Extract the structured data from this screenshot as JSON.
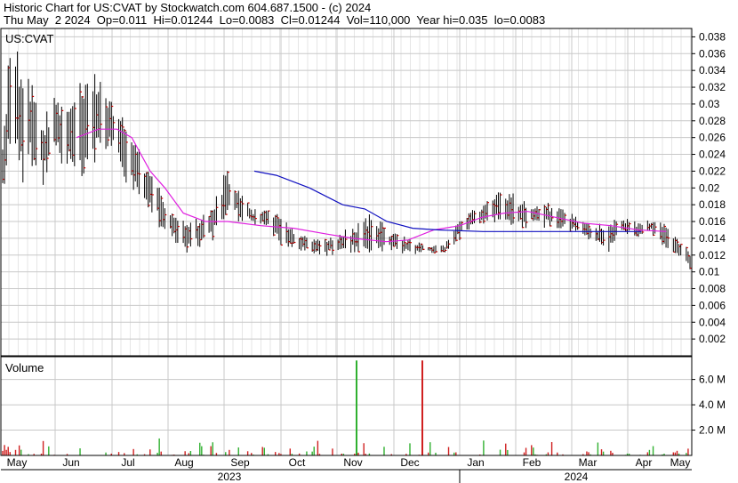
{
  "header": {
    "line1": "Historic Chart for US:CVAT by Stockwatch.com 604.687.1500 - (c) 2024",
    "line2": "Thu May  2 2024  Op=0.011  Hi=0.01244  Lo=0.0083  Cl=0.01244  Vol=110,000  Year hi=0.035  lo=0.0083"
  },
  "symbol": "US:CVAT",
  "volume_label": "Volume",
  "colors": {
    "bar": "#000000",
    "close_tick": "#cc0000",
    "ma_short": "#e020e0",
    "ma_long": "#1010c0",
    "grid": "#c8c8c8",
    "vol_up": "#30b030",
    "vol_down": "#d02020"
  },
  "chart_data": {
    "type": "ohlc",
    "price_axis": {
      "ylim": [
        0,
        0.039
      ],
      "ticks": [
        "0.038",
        "0.036",
        "0.034",
        "0.032",
        "0.03",
        "0.028",
        "0.026",
        "0.024",
        "0.022",
        "0.02",
        "0.018",
        "0.016",
        "0.014",
        "0.012",
        "0.01",
        "0.008",
        "0.006",
        "0.004",
        "0.002"
      ]
    },
    "volume_axis": {
      "ylim": [
        0,
        7.8
      ],
      "unit": "M",
      "ticks": [
        "6.0 M",
        "4.0 M",
        "2.0 M"
      ]
    },
    "x_months": [
      "May",
      "Jun",
      "Jul",
      "Aug",
      "Sep",
      "Oct",
      "Nov",
      "Dec",
      "Jan",
      "Feb",
      "Mar",
      "Apr",
      "May"
    ],
    "years": [
      "2023",
      "2024"
    ],
    "price_anchors": [
      [
        0,
        0.021,
        0.024
      ],
      [
        4,
        0.026,
        0.034
      ],
      [
        10,
        0.024,
        0.032
      ],
      [
        16,
        0.025,
        0.03
      ],
      [
        22,
        0.022,
        0.026
      ],
      [
        28,
        0.025,
        0.03
      ],
      [
        36,
        0.024,
        0.029
      ],
      [
        44,
        0.024,
        0.03
      ],
      [
        48,
        0.027,
        0.033
      ],
      [
        52,
        0.025,
        0.031
      ],
      [
        58,
        0.026,
        0.03
      ],
      [
        64,
        0.023,
        0.027
      ],
      [
        72,
        0.021,
        0.024
      ],
      [
        80,
        0.018,
        0.021
      ],
      [
        90,
        0.015,
        0.017
      ],
      [
        100,
        0.013,
        0.015
      ],
      [
        108,
        0.014,
        0.016
      ],
      [
        115,
        0.015,
        0.018
      ],
      [
        122,
        0.018,
        0.021
      ],
      [
        128,
        0.017,
        0.019
      ],
      [
        136,
        0.016,
        0.017
      ],
      [
        144,
        0.016,
        0.017
      ],
      [
        150,
        0.014,
        0.016
      ],
      [
        160,
        0.013,
        0.014
      ],
      [
        170,
        0.0125,
        0.0135
      ],
      [
        180,
        0.0125,
        0.014
      ],
      [
        190,
        0.013,
        0.0145
      ],
      [
        200,
        0.0135,
        0.016
      ],
      [
        210,
        0.013,
        0.0145
      ],
      [
        220,
        0.0125,
        0.0135
      ],
      [
        230,
        0.0125,
        0.013
      ],
      [
        240,
        0.0125,
        0.013
      ],
      [
        248,
        0.0145,
        0.016
      ],
      [
        256,
        0.016,
        0.017
      ],
      [
        264,
        0.016,
        0.018
      ],
      [
        272,
        0.017,
        0.019
      ],
      [
        280,
        0.016,
        0.018
      ],
      [
        288,
        0.016,
        0.0175
      ],
      [
        296,
        0.016,
        0.0175
      ],
      [
        304,
        0.0155,
        0.017
      ],
      [
        312,
        0.015,
        0.016
      ],
      [
        320,
        0.014,
        0.015
      ],
      [
        328,
        0.013,
        0.015
      ],
      [
        336,
        0.015,
        0.016
      ],
      [
        344,
        0.0145,
        0.0155
      ],
      [
        352,
        0.015,
        0.016
      ],
      [
        360,
        0.0135,
        0.015
      ],
      [
        368,
        0.012,
        0.013
      ],
      [
        373,
        0.0105,
        0.012
      ]
    ],
    "ma_short": [
      [
        0,
        0.026
      ],
      [
        12,
        0.027
      ],
      [
        22,
        0.027
      ],
      [
        30,
        0.026
      ],
      [
        40,
        0.022
      ],
      [
        48,
        0.02
      ],
      [
        58,
        0.017
      ],
      [
        70,
        0.016
      ],
      [
        82,
        0.016
      ],
      [
        100,
        0.0155
      ],
      [
        118,
        0.0152
      ],
      [
        136,
        0.0145
      ],
      [
        150,
        0.014
      ],
      [
        168,
        0.0136
      ],
      [
        180,
        0.0138
      ],
      [
        194,
        0.015
      ],
      [
        208,
        0.0155
      ],
      [
        220,
        0.0165
      ],
      [
        232,
        0.017
      ],
      [
        245,
        0.0172
      ],
      [
        260,
        0.0165
      ],
      [
        275,
        0.0158
      ],
      [
        290,
        0.0155
      ],
      [
        305,
        0.015
      ],
      [
        320,
        0.0148
      ],
      [
        336,
        0.0146
      ],
      [
        350,
        0.014
      ],
      [
        360,
        0.0138
      ]
    ],
    "ma_long": [
      [
        0,
        0.022
      ],
      [
        12,
        0.0215
      ],
      [
        30,
        0.02
      ],
      [
        48,
        0.018
      ],
      [
        60,
        0.0175
      ],
      [
        72,
        0.016
      ],
      [
        86,
        0.0152
      ],
      [
        100,
        0.015
      ],
      [
        124,
        0.0148
      ],
      [
        150,
        0.0148
      ],
      [
        180,
        0.0148
      ],
      [
        210,
        0.0148
      ],
      [
        240,
        0.0147
      ],
      [
        270,
        0.0147
      ]
    ],
    "volume_spikes": [
      {
        "month": "Nov",
        "value": 7.5,
        "color": "up"
      },
      {
        "month": "Dec",
        "value": 7.5,
        "color": "down"
      }
    ]
  }
}
